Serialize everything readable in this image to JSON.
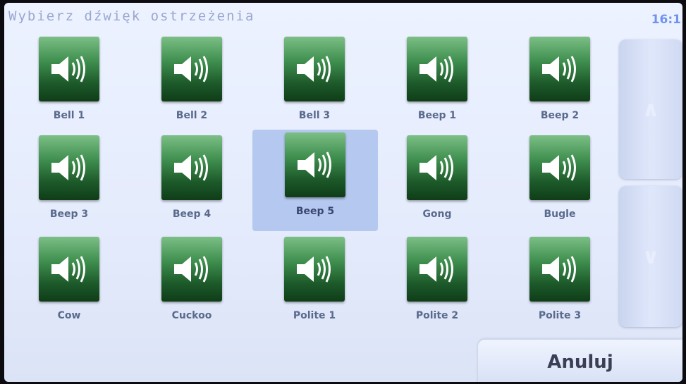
{
  "header": {
    "title": "Wybierz dźwięk ostrzeżenia",
    "clock": "16:1"
  },
  "sounds": [
    {
      "label": "Bell 1"
    },
    {
      "label": "Bell 2"
    },
    {
      "label": "Bell 3"
    },
    {
      "label": "Beep 1"
    },
    {
      "label": "Beep 2"
    },
    {
      "label": "Beep 3"
    },
    {
      "label": "Beep 4"
    },
    {
      "label": "Beep 5",
      "selected": true
    },
    {
      "label": "Gong"
    },
    {
      "label": "Bugle"
    },
    {
      "label": "Cow"
    },
    {
      "label": "Cuckoo"
    },
    {
      "label": "Polite 1"
    },
    {
      "label": "Polite 2"
    },
    {
      "label": "Polite 3"
    }
  ],
  "scroll": {
    "up_glyph": "∧",
    "down_glyph": "∨"
  },
  "footer": {
    "cancel_label": "Anuluj"
  }
}
